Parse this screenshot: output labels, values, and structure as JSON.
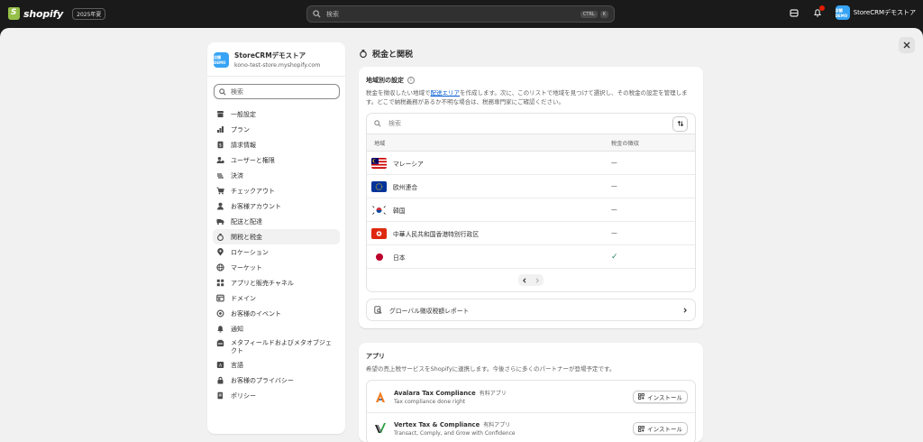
{
  "topbar": {
    "brand": "shopify",
    "edition_badge": "2025年夏",
    "search_placeholder": "検索",
    "shortcut_ctrl": "CTRL",
    "shortcut_key": "K",
    "store_avatar_text": "店舗DEMO",
    "store_name": "StoreCRMデモストア"
  },
  "sidebar": {
    "store_name": "StoreCRMデモストア",
    "store_domain": "kono-test-store.myshopify.com",
    "search_placeholder": "検索",
    "items": [
      {
        "label": "一般設定",
        "icon": "store-icon"
      },
      {
        "label": "プラン",
        "icon": "plan-icon"
      },
      {
        "label": "請求情報",
        "icon": "billing-icon"
      },
      {
        "label": "ユーザーと権限",
        "icon": "users-icon"
      },
      {
        "label": "決済",
        "icon": "payments-icon"
      },
      {
        "label": "チェックアウト",
        "icon": "cart-icon"
      },
      {
        "label": "お客様アカウント",
        "icon": "person-icon"
      },
      {
        "label": "配送と配達",
        "icon": "truck-icon"
      },
      {
        "label": "関税と税金",
        "icon": "tax-bag-icon",
        "active": true
      },
      {
        "label": "ロケーション",
        "icon": "location-icon"
      },
      {
        "label": "マーケット",
        "icon": "globe-icon"
      },
      {
        "label": "アプリと販売チャネル",
        "icon": "apps-icon"
      },
      {
        "label": "ドメイン",
        "icon": "domain-icon"
      },
      {
        "label": "お客様のイベント",
        "icon": "events-icon"
      },
      {
        "label": "通知",
        "icon": "bell-icon"
      },
      {
        "label": "メタフィールドおよびメタオブジェクト",
        "icon": "metafield-icon"
      },
      {
        "label": "言語",
        "icon": "language-icon"
      },
      {
        "label": "お客様のプライバシー",
        "icon": "lock-icon"
      },
      {
        "label": "ポリシー",
        "icon": "policy-icon"
      }
    ]
  },
  "page": {
    "title": "税金と関税"
  },
  "regions_card": {
    "title": "地域別の設定",
    "desc_before": "税金を徴収したい地域で",
    "desc_link": "配送エリア",
    "desc_after": "を作成します。次に、このリストで地域を見つけて選択し、その税金の設定を管理します。どこで納税義務があるか不明な場合は、税務専門家にご確認ください。",
    "search_placeholder": "検索",
    "col_region": "地域",
    "col_collection": "税金の徴収",
    "rows": [
      {
        "name": "マレーシア",
        "status": "—"
      },
      {
        "name": "欧州連合",
        "status": "—"
      },
      {
        "name": "韓国",
        "status": "—"
      },
      {
        "name": "中華人民共和国香港特別行政区",
        "status": "—"
      },
      {
        "name": "日本",
        "status": "✓"
      }
    ],
    "report_label": "グローバル徴収税額レポート"
  },
  "apps_card": {
    "title": "アプリ",
    "desc": "希望の売上税サービスをShopifyに連携します。今後さらに多くのパートナーが登場予定です。",
    "apps": [
      {
        "name": "Avalara Tax Compliance",
        "tag": "有料アプリ",
        "sub": "Tax compliance done right",
        "button": "インストール"
      },
      {
        "name": "Vertex Tax & Compliance",
        "tag": "有料アプリ",
        "sub": "Transact, Comply, and Grow with Confidence",
        "button": "インストール"
      }
    ]
  },
  "colors": {
    "accent_link": "#005bd3",
    "highlight_border": "#e10000",
    "check_green": "#29845a",
    "avatar_blue": "#36a3f5"
  }
}
